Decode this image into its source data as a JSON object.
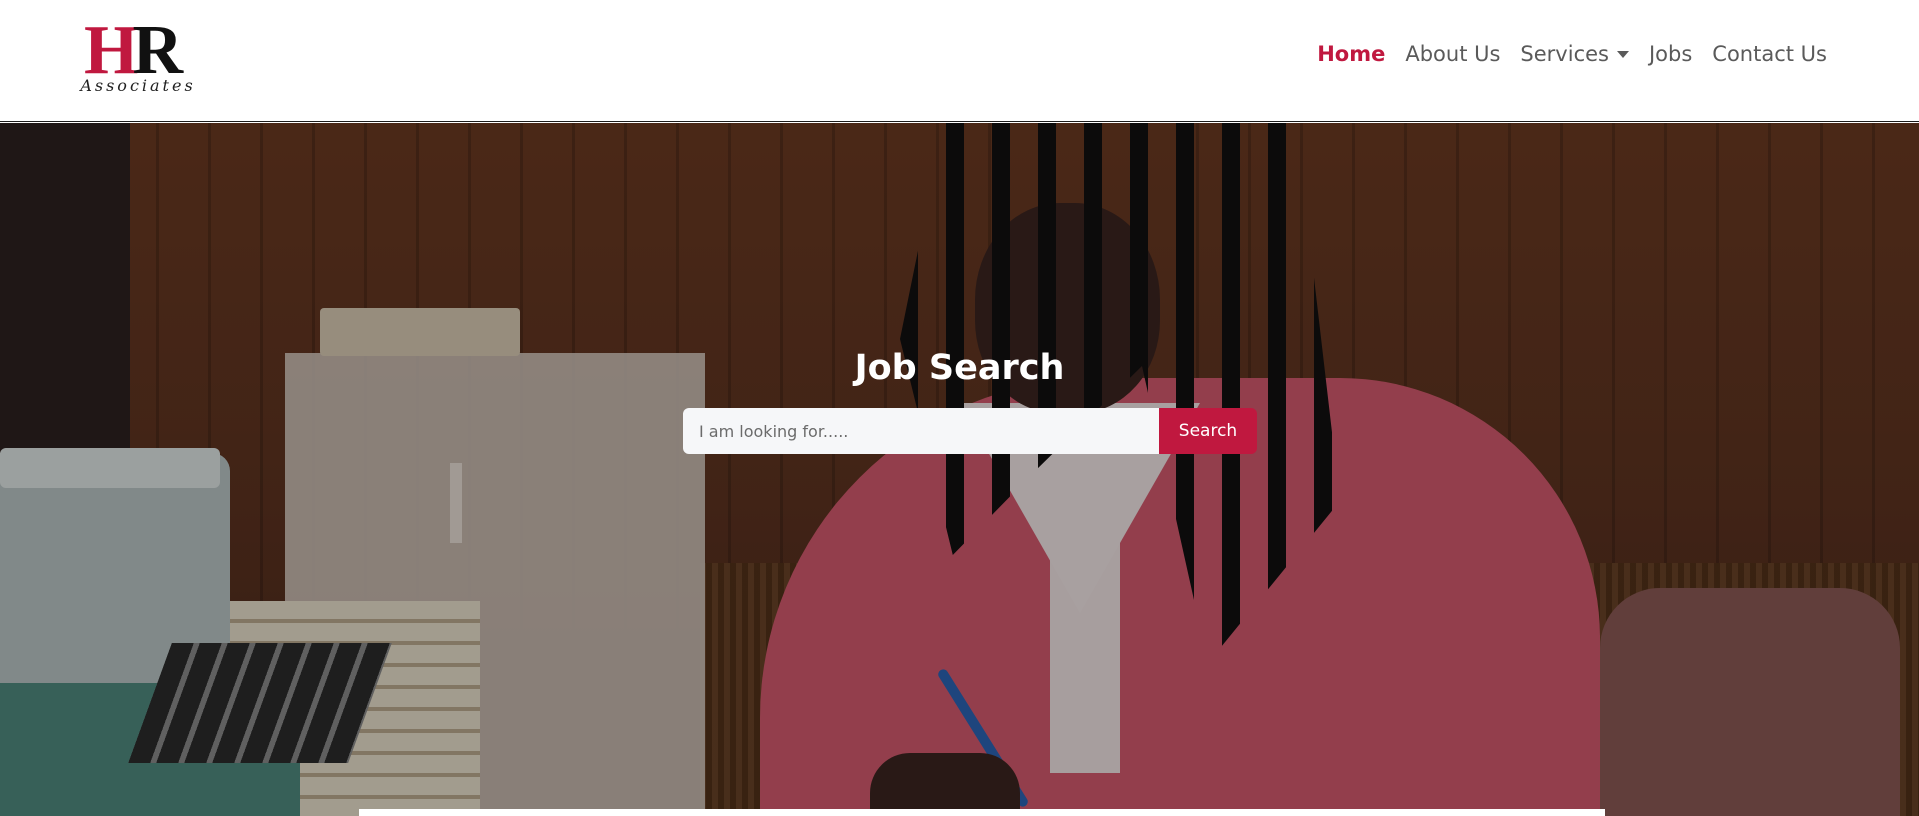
{
  "brand": {
    "logo_letters_first": "H",
    "logo_letters_second": "R",
    "logo_subtitle": "Associates",
    "accent_color": "#c0183f"
  },
  "nav": {
    "items": [
      {
        "label": "Home",
        "active": true
      },
      {
        "label": "About Us",
        "active": false
      },
      {
        "label": "Services",
        "active": false,
        "has_dropdown": true
      },
      {
        "label": "Jobs",
        "active": false
      },
      {
        "label": "Contact Us",
        "active": false
      }
    ]
  },
  "hero": {
    "title": "Job Search",
    "search": {
      "placeholder": "I am looking for.....",
      "value": "",
      "button_label": "Search"
    }
  }
}
